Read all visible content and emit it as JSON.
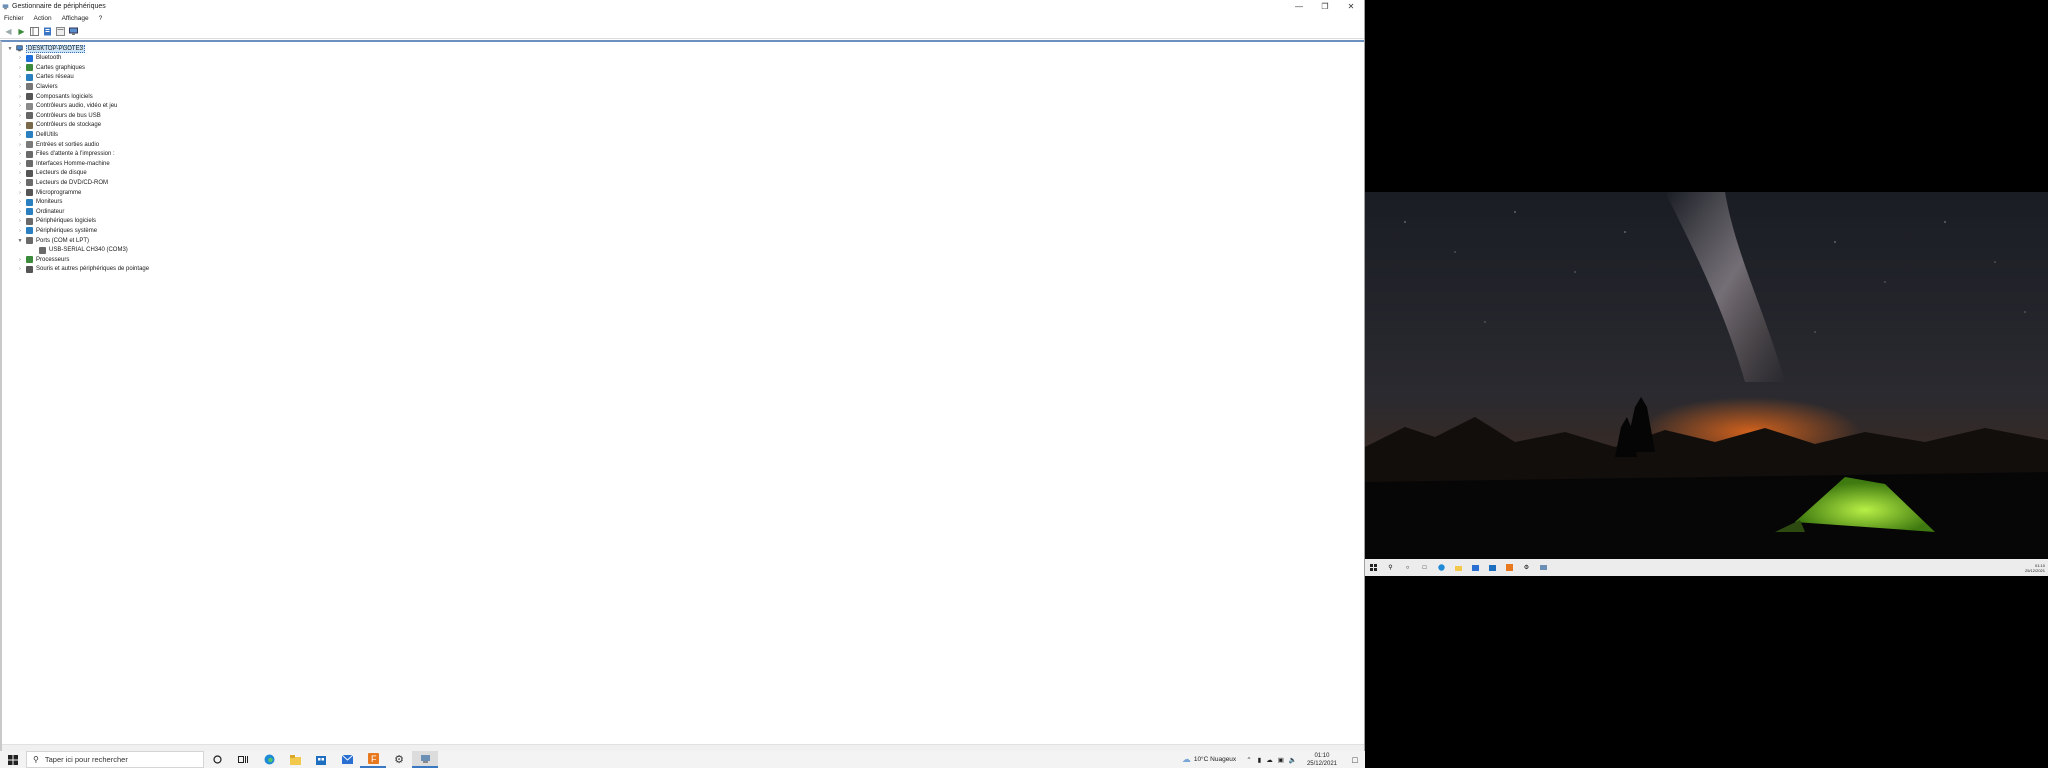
{
  "window": {
    "title": "Gestionnaire de périphériques",
    "menu": [
      "Fichier",
      "Action",
      "Affichage",
      "?"
    ]
  },
  "tree": {
    "root": "DESKTOP-PGOTE3",
    "categories": [
      {
        "label": "Bluetooth",
        "icon": "bluetooth-icon",
        "color": "#1e6fd9"
      },
      {
        "label": "Cartes graphiques",
        "icon": "display-adapter-icon",
        "color": "#3c8a3c"
      },
      {
        "label": "Cartes réseau",
        "icon": "network-icon",
        "color": "#2a7fc0"
      },
      {
        "label": "Claviers",
        "icon": "keyboard-icon",
        "color": "#777777"
      },
      {
        "label": "Composants logiciels",
        "icon": "software-component-icon",
        "color": "#555555"
      },
      {
        "label": "Contrôleurs audio, vidéo et jeu",
        "icon": "audio-icon",
        "color": "#8a8a8a"
      },
      {
        "label": "Contrôleurs de bus USB",
        "icon": "usb-icon",
        "color": "#666666"
      },
      {
        "label": "Contrôleurs de stockage",
        "icon": "storage-controller-icon",
        "color": "#7a6a4a"
      },
      {
        "label": "DellUtils",
        "icon": "folder-icon",
        "color": "#2a7fc0"
      },
      {
        "label": "Entrées et sorties audio",
        "icon": "speaker-icon",
        "color": "#7a7a7a"
      },
      {
        "label": "Files d'attente à l'impression :",
        "icon": "printer-icon",
        "color": "#6a6a6a"
      },
      {
        "label": "Interfaces Homme-machine",
        "icon": "hid-icon",
        "color": "#6a6a6a"
      },
      {
        "label": "Lecteurs de disque",
        "icon": "disk-drive-icon",
        "color": "#555555"
      },
      {
        "label": "Lecteurs de DVD/CD-ROM",
        "icon": "dvd-icon",
        "color": "#6a6a6a"
      },
      {
        "label": "Microprogramme",
        "icon": "firmware-icon",
        "color": "#555555"
      },
      {
        "label": "Moniteurs",
        "icon": "monitor-icon",
        "color": "#2a7fc0"
      },
      {
        "label": "Ordinateur",
        "icon": "computer-icon",
        "color": "#2a7fc0"
      },
      {
        "label": "Périphériques logiciels",
        "icon": "software-device-icon",
        "color": "#6a6a6a"
      },
      {
        "label": "Périphériques système",
        "icon": "system-device-icon",
        "color": "#2a7fc0"
      },
      {
        "label": "Ports (COM et LPT)",
        "icon": "port-icon",
        "color": "#6a6a6a",
        "expanded": true,
        "children": [
          {
            "label": "USB-SERIAL CH340 (COM3)",
            "icon": "port-icon",
            "color": "#6a6a6a"
          }
        ]
      },
      {
        "label": "Processeurs",
        "icon": "processor-icon",
        "color": "#3c8a3c"
      },
      {
        "label": "Souris et autres périphériques de pointage",
        "icon": "mouse-icon",
        "color": "#555555"
      }
    ]
  },
  "taskbar": {
    "search_placeholder": "Taper ici pour rechercher",
    "weather": "10°C  Nuageux",
    "time": "01:10",
    "date": "25/12/2021",
    "apps": [
      "cortana-icon",
      "task-view-icon",
      "edge-icon",
      "file-explorer-icon",
      "store-icon",
      "mail-icon",
      "firefox-icon",
      "settings-icon",
      "device-manager-icon"
    ]
  },
  "right_taskbar": {
    "time": "01:10",
    "date": "25/12/2021"
  }
}
